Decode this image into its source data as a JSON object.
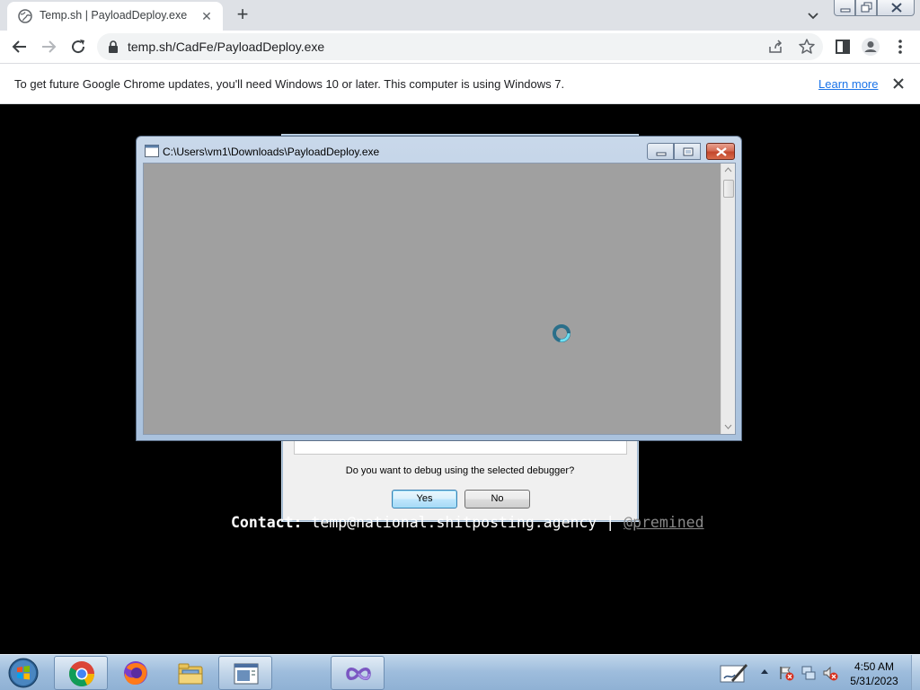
{
  "browser": {
    "tab": {
      "title": "Temp.sh | PayloadDeploy.exe",
      "close_glyph": "✕",
      "favicon": "globe-icon"
    },
    "new_tab_glyph": "+",
    "url": "temp.sh/CadFe/PayloadDeploy.exe",
    "infobar": {
      "message": "To get future Google Chrome updates, you'll need Windows 10 or later. This computer is using Windows 7.",
      "link": "Learn more"
    }
  },
  "payload_window": {
    "title": "C:\\Users\\vm1\\Downloads\\PayloadDeploy.exe"
  },
  "debug_dialog": {
    "question": "Do you want to debug using the selected debugger?",
    "yes_label": "Yes",
    "no_label": "No"
  },
  "page": {
    "contact_label": "Contact:",
    "contact_email": "temp@national.shitposting.agency",
    "contact_separator": "|",
    "contact_handle": "@premined"
  },
  "taskbar": {
    "apps": [
      "chrome-icon",
      "firefox-icon",
      "explorer-icon",
      "window-icon",
      "visual-studio-icon"
    ],
    "time": "4:50 AM",
    "date": "5/31/2023"
  },
  "colors": {
    "chrome_link": "#1a73e8",
    "taskbar": "#9dbcdc",
    "client_gray": "#a0a0a0"
  }
}
